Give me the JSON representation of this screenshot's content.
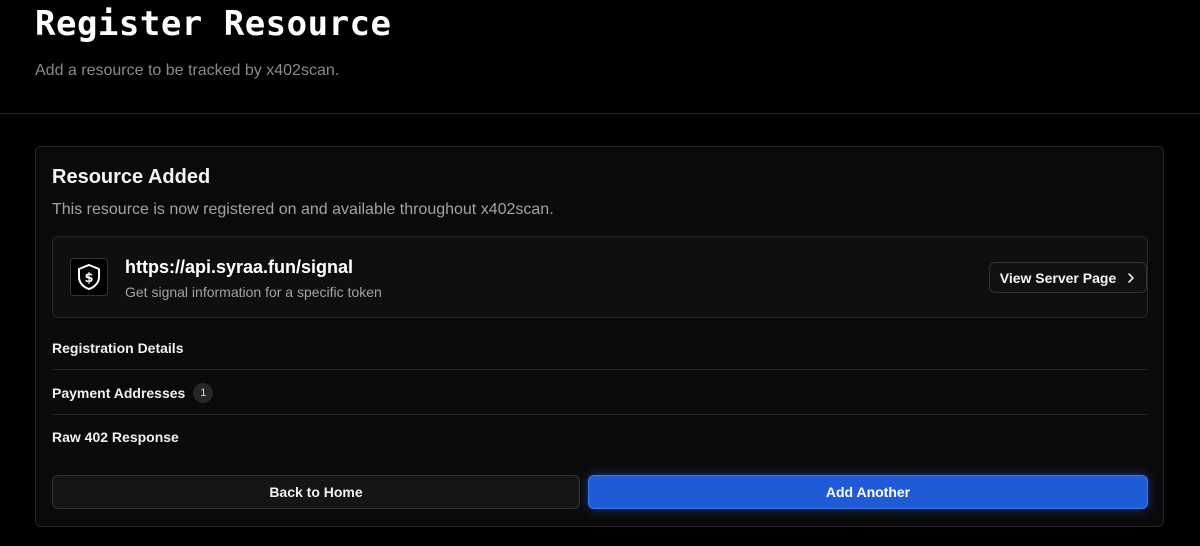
{
  "header": {
    "title": "Register Resource",
    "subtitle": "Add a resource to be tracked by x402scan."
  },
  "card": {
    "title": "Resource Added",
    "description": "This resource is now registered on and available throughout x402scan.",
    "resource": {
      "icon": "dollar-shield-icon",
      "url": "https://api.syraa.fun/signal",
      "description": "Get signal information for a specific token",
      "view_button_label": "View Server Page",
      "view_button_icon": "chevron-right-icon"
    },
    "sections": {
      "registration_details": "Registration Details",
      "payment_addresses": "Payment Addresses",
      "payment_addresses_count": "1",
      "raw_response": "Raw 402 Response"
    },
    "actions": {
      "back_label": "Back to Home",
      "add_label": "Add Another"
    }
  },
  "colors": {
    "background": "#000000",
    "card": "#0a0a0a",
    "accent": "#1f5bd6"
  }
}
